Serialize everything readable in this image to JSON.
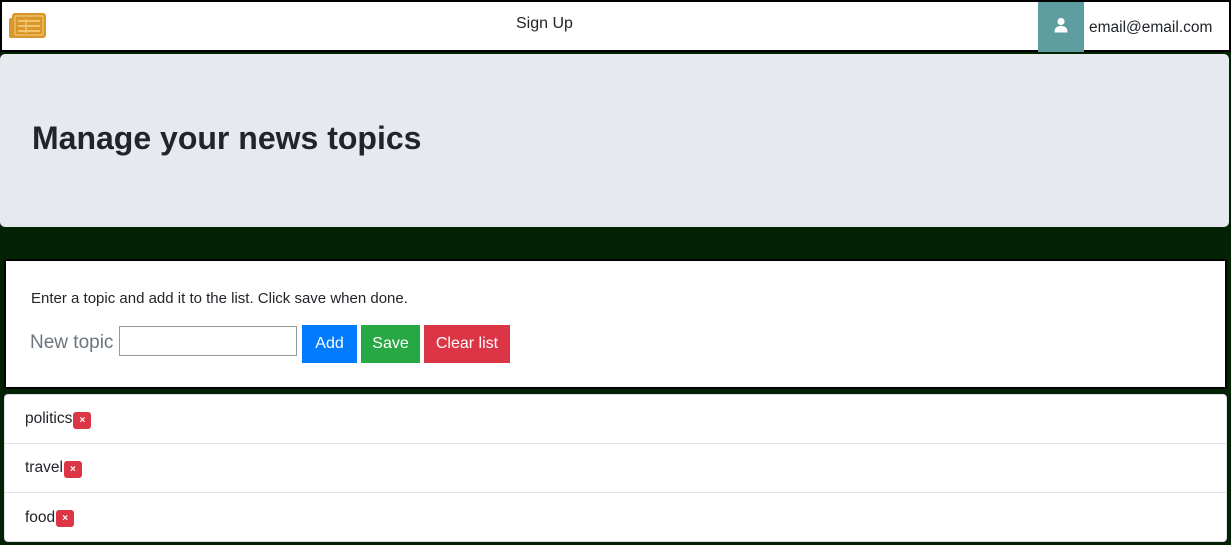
{
  "header": {
    "logo_icon": "newspaper-icon",
    "signup_label": "Sign Up",
    "user_icon": "user-icon",
    "user_email": "email@email.com"
  },
  "jumbotron": {
    "title": "Manage your news topics"
  },
  "entry": {
    "instructions": "Enter a topic and add it to the list. Click save when done.",
    "new_topic_label": "New topic",
    "input_value": "",
    "add_label": "Add",
    "save_label": "Save",
    "clear_label": "Clear list"
  },
  "topics": [
    {
      "name": "politics",
      "remove_label": "×"
    },
    {
      "name": "travel",
      "remove_label": "×"
    },
    {
      "name": "food",
      "remove_label": "×"
    }
  ],
  "colors": {
    "page_background": "#032203",
    "avatar_background": "#5f9ea0",
    "logo": "#d9962b",
    "add_button": "#007bff",
    "save_button": "#28a745",
    "clear_button": "#dc3545",
    "jumbotron_background": "#e6e9ed"
  }
}
